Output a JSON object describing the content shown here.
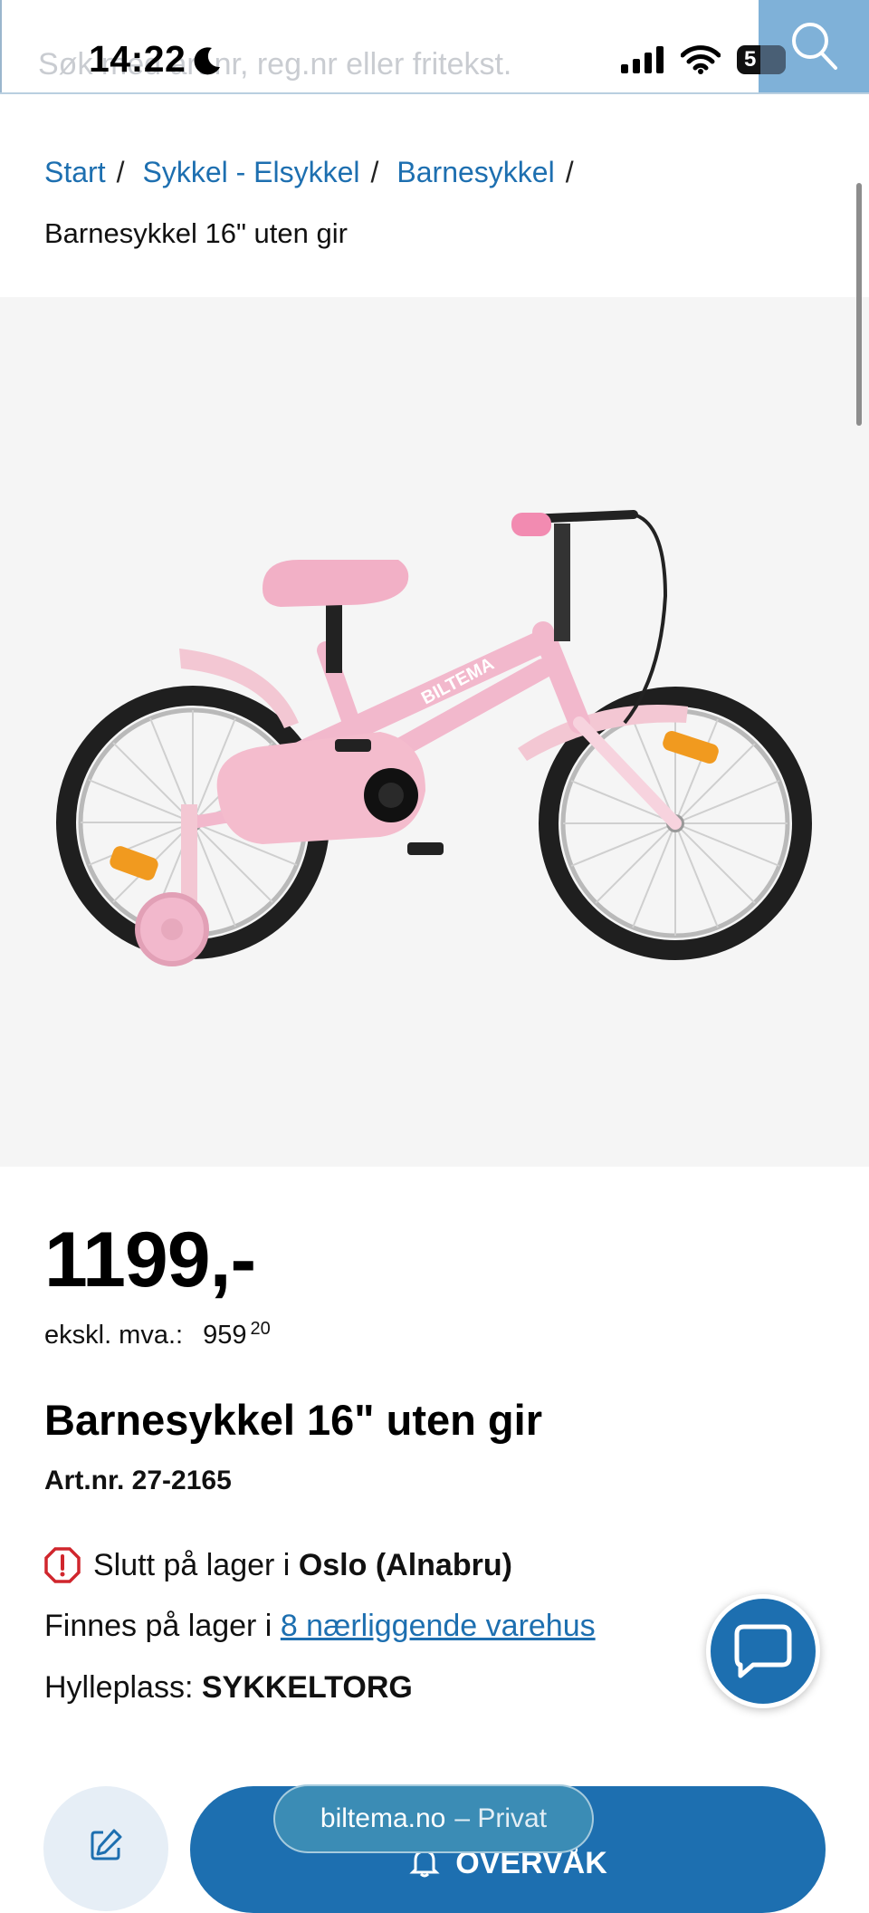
{
  "status_bar": {
    "time": "14:22",
    "battery": "5"
  },
  "search": {
    "placeholder": "Søk med art.nr, reg.nr eller fritekst."
  },
  "breadcrumb": {
    "items": [
      "Start",
      "Sykkel - Elsykkel",
      "Barnesykkel"
    ],
    "separator": "/",
    "current": "Barnesykkel 16\" uten gir"
  },
  "product": {
    "price": "1199,-",
    "ex_vat_label": "ekskl. mva.:",
    "ex_vat_value": "959",
    "ex_vat_cents": "20",
    "title": "Barnesykkel 16\" uten gir",
    "art_nr": "Art.nr. 27-2165",
    "stock_out_prefix": "Slutt på lager i",
    "stock_out_store": "Oslo (Alnabru)",
    "available_prefix": "Finnes på lager i",
    "available_link": "8 nærliggende varehus",
    "shelf_label": "Hylleplass:",
    "shelf_value": "SYKKELTORG",
    "image_brand_text": "BILTEMA"
  },
  "actions": {
    "watch_label": "OVERVÅK"
  },
  "browser": {
    "url": "biltema.no",
    "mode": "– Privat"
  },
  "colors": {
    "brand_blue": "#1d6fb0",
    "bike_pink": "#f2b8cc",
    "warning_red": "#d0262d"
  }
}
